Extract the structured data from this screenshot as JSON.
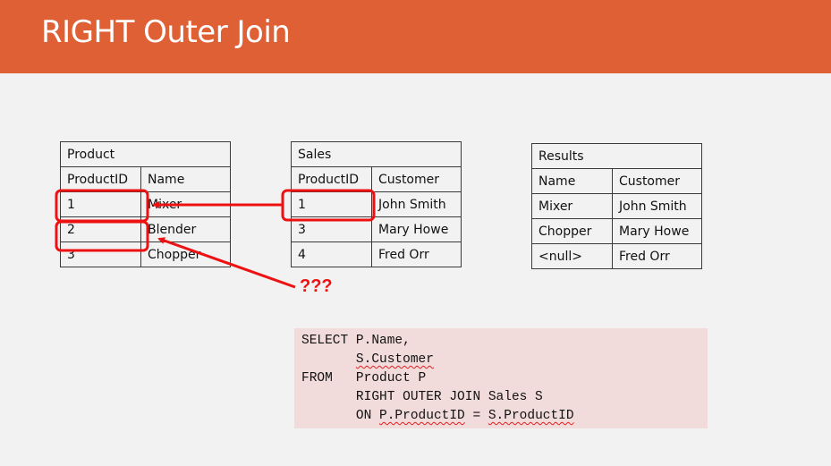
{
  "slide": {
    "title": "RIGHT Outer Join",
    "accent_color": "#e06035",
    "highlight_color": "#ee1111"
  },
  "product_table": {
    "caption": "Product",
    "headers": [
      "ProductID",
      "Name"
    ],
    "rows": [
      [
        "1",
        "Mixer"
      ],
      [
        "2",
        "Blender"
      ],
      [
        "3",
        "Chopper"
      ]
    ]
  },
  "sales_table": {
    "caption": "Sales",
    "headers": [
      "ProductID",
      "Customer"
    ],
    "rows": [
      [
        "1",
        "John Smith"
      ],
      [
        "3",
        "Mary Howe"
      ],
      [
        "4",
        "Fred Orr"
      ]
    ]
  },
  "results_table": {
    "caption": "Results",
    "headers": [
      "Name",
      "Customer"
    ],
    "rows": [
      [
        "Mixer",
        "John Smith"
      ],
      [
        "Chopper",
        "Mary Howe"
      ],
      [
        "<null>",
        "Fred Orr"
      ]
    ]
  },
  "annotation": {
    "question_marks": "???"
  },
  "sql": {
    "line1_kw": "SELECT ",
    "line1_rest": "P.Name,",
    "line2_indent": "       ",
    "line2": "S.Customer",
    "line3_kw": "FROM   ",
    "line3_rest": "Product P",
    "line4": "RIGHT OUTER JOIN Sales S",
    "line5_on": "ON ",
    "line5_left": "P.ProductID",
    "line5_eq": " = ",
    "line5_right": "S.ProductID"
  }
}
